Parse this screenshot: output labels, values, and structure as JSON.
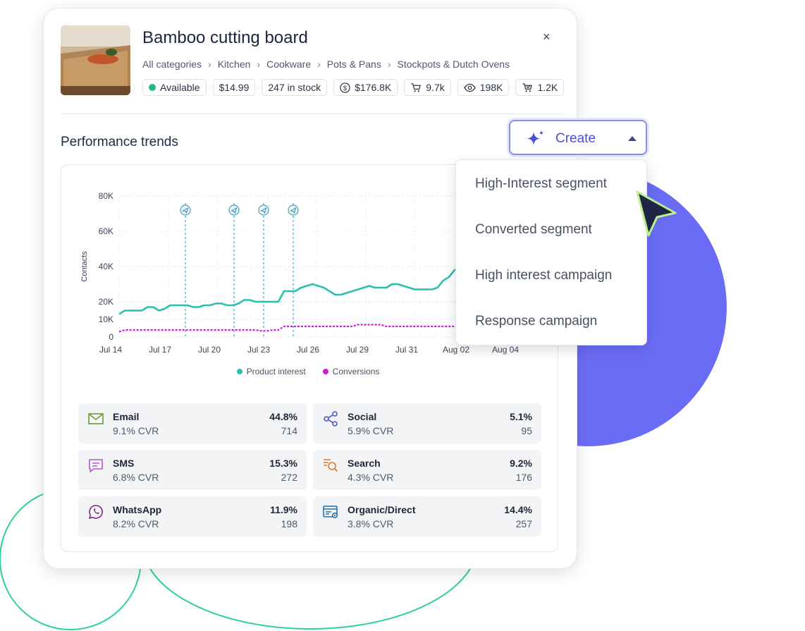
{
  "product": {
    "title": "Bamboo cutting board",
    "close_icon": "×",
    "breadcrumbs": [
      "All categories",
      "Kitchen",
      "Cookware",
      "Pots & Pans",
      "Stockpots & Dutch Ovens"
    ],
    "chips": {
      "status": "Available",
      "price": "$14.99",
      "stock": "247 in stock",
      "revenue": "$176.8K",
      "cart": "9.7k",
      "views": "198K",
      "purchases": "1.2K"
    }
  },
  "section": {
    "title": "Performance trends"
  },
  "create_button": {
    "label": "Create",
    "icon": "sparkle-icon"
  },
  "dropdown": {
    "items": [
      "High-Interest segment",
      "Converted segment",
      "High interest campaign",
      "Response campaign"
    ]
  },
  "chart_data": {
    "type": "line",
    "ylabel": "Contacts",
    "ylim": [
      0,
      80000
    ],
    "yticks": [
      "80K",
      "60K",
      "40K",
      "20K",
      "10K",
      "0"
    ],
    "xticks": [
      "Jul 14",
      "Jul 17",
      "Jul 20",
      "Jul 23",
      "Jul 26",
      "Jul 29",
      "Jul 31",
      "Aug 02",
      "Aug 04"
    ],
    "grid": true,
    "legend_position": "bottom",
    "campaign_markers": [
      "Jul 18",
      "Jul 21",
      "Jul 23",
      "Jul 25"
    ],
    "series": [
      {
        "name": "Product interest",
        "color": "#2bbfae",
        "values": [
          13000,
          15000,
          15000,
          15000,
          15000,
          17000,
          17000,
          15000,
          16000,
          18000,
          18000,
          18000,
          18000,
          17000,
          17000,
          18000,
          18000,
          19000,
          19000,
          18000,
          18000,
          19000,
          21000,
          21000,
          20000,
          20000,
          20000,
          20000,
          20000,
          26000,
          26000,
          26000,
          28000,
          29000,
          30000,
          29000,
          28000,
          26000,
          24000,
          24000,
          25000,
          26000,
          27000,
          28000,
          29000,
          28000,
          28000,
          28000,
          30000,
          30000,
          29000,
          28000,
          27000,
          27000,
          27000,
          27000,
          28000,
          32000,
          34000,
          38000,
          40000,
          40000
        ]
      },
      {
        "name": "Conversions",
        "color": "#d21ad6",
        "values": [
          3000,
          4000,
          4000,
          4000,
          4000,
          4000,
          4000,
          4000,
          4000,
          4000,
          4000,
          4000,
          4000,
          4000,
          4000,
          4000,
          4000,
          4000,
          4000,
          4000,
          4000,
          4000,
          4000,
          4000,
          4000,
          3500,
          3500,
          4000,
          4000,
          6000,
          6000,
          6000,
          6000,
          6000,
          6000,
          6000,
          6000,
          6000,
          6000,
          6000,
          6000,
          6000,
          7000,
          7000,
          7000,
          7000,
          7000,
          6000,
          6000,
          6000,
          6000,
          6000,
          6000,
          6000,
          6000,
          6000,
          6000,
          6000,
          6000,
          6000,
          6000,
          6000
        ]
      }
    ]
  },
  "channels": [
    {
      "name": "Email",
      "cvr": "9.1% CVR",
      "percent": "44.8%",
      "count": "714",
      "icon": "mail-icon",
      "color": "#6a9b3f"
    },
    {
      "name": "Social",
      "cvr": "5.9% CVR",
      "percent": "5.1%",
      "count": "95",
      "icon": "share-icon",
      "color": "#4a58c0"
    },
    {
      "name": "SMS",
      "cvr": "6.8% CVR",
      "percent": "15.3%",
      "count": "272",
      "icon": "chat-icon",
      "color": "#b55bc9"
    },
    {
      "name": "Search",
      "cvr": "4.3% CVR",
      "percent": "9.2%",
      "count": "176",
      "icon": "search-icon",
      "color": "#e07a2b"
    },
    {
      "name": "WhatsApp",
      "cvr": "8.2% CVR",
      "percent": "11.9%",
      "count": "198",
      "icon": "whatsapp-icon",
      "color": "#7b2a7e"
    },
    {
      "name": "Organic/Direct",
      "cvr": "3.8% CVR",
      "percent": "14.4%",
      "count": "257",
      "icon": "browser-icon",
      "color": "#2a6fa8"
    }
  ],
  "colors": {
    "accent": "#6b6cf5",
    "outline": "#2fd28a",
    "card_border": "#e3e6ec"
  }
}
